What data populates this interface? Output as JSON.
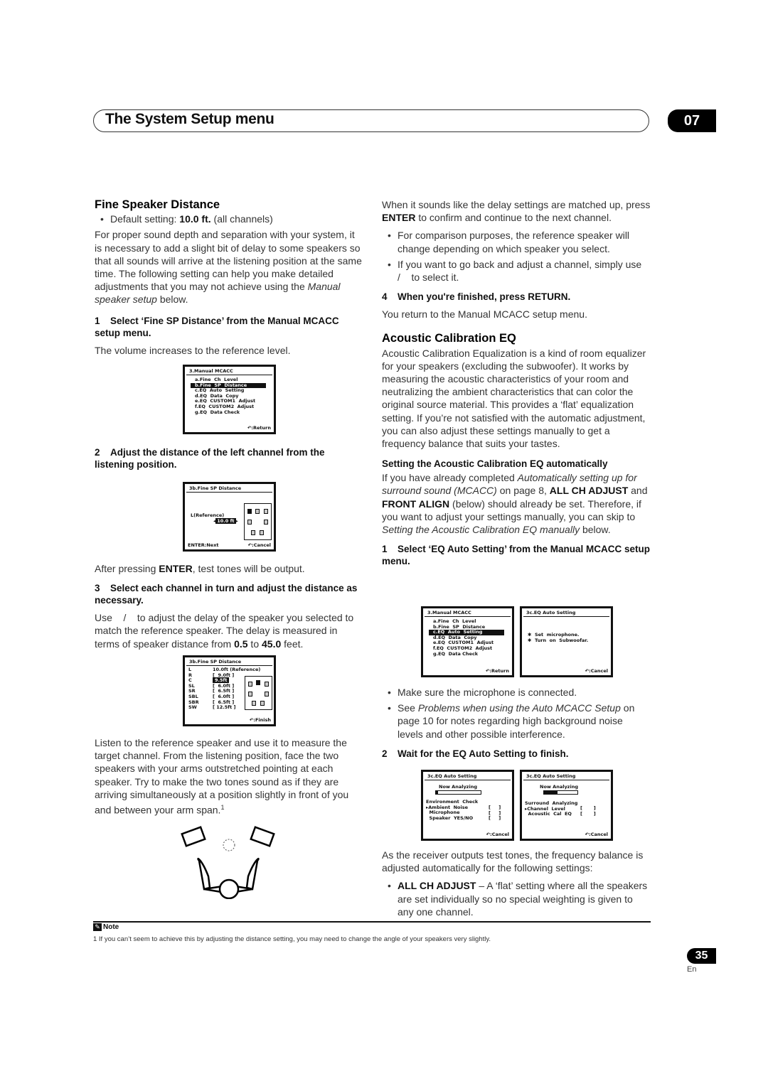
{
  "header": {
    "title": "The System Setup menu",
    "chapter": "07"
  },
  "left": {
    "section_title": "Fine Speaker Distance",
    "default_prefix": "Default setting: ",
    "default_value": "10.0 ft.",
    "default_suffix": " (all channels)",
    "intro_1": "For proper sound depth and separation with your system, it is necessary to add a slight bit of delay to some speakers so that all sounds will arrive at the listening position at the same time. The following setting can help you make detailed adjustments that you may not achieve using the ",
    "intro_link": "Manual speaker setup",
    "intro_2": " below.",
    "step1_num": "1",
    "step1": "Select ‘Fine SP Distance’ from the Manual MCACC setup menu.",
    "step1_body": "The volume increases to the reference level.",
    "step2_num": "2",
    "step2": "Adjust the distance of the left channel from the listening position.",
    "after_enter_1": "After pressing ",
    "after_enter_b": "ENTER",
    "after_enter_2": ", test tones will be output.",
    "step3_num": "3",
    "step3": "Select each channel in turn and adjust the distance as necessary.",
    "step3_body_1": "Use    /    to adjust the delay of the speaker you selected to match the reference speaker. The delay is measured in terms of speaker distance from ",
    "step3_min": "0.5",
    "step3_to": " to ",
    "step3_max": "45.0",
    "step3_body_2": " feet.",
    "listen": "Listen to the reference speaker and use it to measure the target channel. From the listening position, face the two speakers with your arms outstretched pointing at each speaker. Try to make the two tones sound as if they are arriving simultaneously at a position slightly in front of you and between your arm span.",
    "listen_sup": "1"
  },
  "osd_menu": {
    "title": "3.Manual  MCACC",
    "items": [
      "a.Fine  Ch  Level",
      "b.Fine  SP  Distance",
      "c.EQ  Auto  Setting",
      "d.EQ  Data  Copy",
      "e.EQ  CUSTOM1  Adjust",
      "f.EQ  CUSTOM2  Adjust",
      "g.EQ  Data Check"
    ],
    "footer": ":Return"
  },
  "osd_distance_ref": {
    "title": "3b.Fine  SP  Distance",
    "label": "L(Reference)",
    "value": "10.0 ft",
    "footer_left": "ENTER:Next",
    "footer_right": ":Cancel"
  },
  "osd_distance_all": {
    "title": "3b.Fine  SP  Distance",
    "rows": [
      {
        "ch": "L",
        "val": "10.0ft (Reference)"
      },
      {
        "ch": "R",
        "val": "[  9.0ft ]"
      },
      {
        "ch": "C",
        "val": "9.5ft"
      },
      {
        "ch": "SL",
        "val": "[  6.0ft ]"
      },
      {
        "ch": "SR",
        "val": "[  6.5ft ]"
      },
      {
        "ch": "SBL",
        "val": "[  6.0ft ]"
      },
      {
        "ch": "SBR",
        "val": "[  6.5ft ]"
      },
      {
        "ch": "SW",
        "val": "[ 12.5ft ]"
      }
    ],
    "footer": ":Finish"
  },
  "right": {
    "p1_1": "When it sounds like the delay settings are matched up, press ",
    "p1_b": "ENTER",
    "p1_2": " to confirm and continue to the next channel.",
    "bullet1": "For comparison purposes, the reference speaker will change depending on which speaker you select.",
    "bullet2": "If you want to go back and adjust a channel, simply use    /    to select it.",
    "step4_num": "4",
    "step4": "When you're finished, press RETURN.",
    "step4_body": "You return to the Manual MCACC setup menu.",
    "eq_title": "Acoustic Calibration EQ",
    "eq_body": "Acoustic Calibration Equalization is a kind of room equalizer for your speakers (excluding the subwoofer). It works by measuring the acoustic characteristics of your room and neutralizing the ambient characteristics that can color the original source material. This provides a ‘flat’ equalization setting. If you’re not satisfied with the automatic adjustment, you can also adjust these settings manually to get a frequency balance that suits your tastes.",
    "auto_title": "Setting the Acoustic Calibration EQ automatically",
    "auto_1": "If you have already completed ",
    "auto_i1": "Automatically setting up for surround sound (MCACC)",
    "auto_2": " on page 8, ",
    "auto_b1": "ALL CH ADJUST",
    "auto_3": " and ",
    "auto_b2": "FRONT ALIGN",
    "auto_4": " (below) should already be set. Therefore, if you want to adjust your settings manually, you can skip to ",
    "auto_i2": "Setting the Acoustic Calibration EQ manually",
    "auto_5": " below.",
    "step1_num": "1",
    "step1": "Select ‘EQ Auto Setting’ from the Manual MCACC setup menu.",
    "bullet3": "Make sure the microphone is connected.",
    "bullet4_1": "See ",
    "bullet4_i": "Problems when using the Auto MCACC Setup",
    "bullet4_2": " on page 10 for notes regarding high background noise levels and other possible interference.",
    "step2_num": "2",
    "step2": "Wait for the EQ Auto Setting to finish.",
    "final_p": "As the receiver outputs test tones, the frequency balance is adjusted automatically for the following settings:",
    "bullet5_b": "ALL CH ADJUST",
    "bullet5": " – A ‘flat’ setting where all the speakers are set individually so no special weighting is given to any one channel."
  },
  "osd_eq_start": {
    "title": "3c.EQ  Auto  Setting",
    "items": [
      "✱  Set  microphone.",
      "✱  Turn  on  Subwoofar."
    ],
    "footer": ":Cancel"
  },
  "osd_eq_env": {
    "title": "3c.EQ  Auto  Setting",
    "analyzing": "Now  Analyzing",
    "progress": 0.05,
    "section": "Environment  Check",
    "items": [
      "▸Ambient  Noise",
      "  Microphone",
      "  Speaker  YES/NO"
    ],
    "footer": ":Cancel"
  },
  "osd_eq_surround": {
    "title": "3c.EQ  Auto  Setting",
    "analyzing": "Now  Analyzing",
    "progress": 0.4,
    "section": "Surround  Analyzing",
    "items": [
      "▸Channel  Level",
      "  Acoustic  Cal  EQ"
    ],
    "footer": ":Cancel"
  },
  "note": {
    "label": "Note",
    "footnote": "1  If you can’t seem to achieve this by adjusting the distance setting, you may need to change the angle of your speakers very slightly."
  },
  "page": {
    "number": "35",
    "lang": "En"
  }
}
